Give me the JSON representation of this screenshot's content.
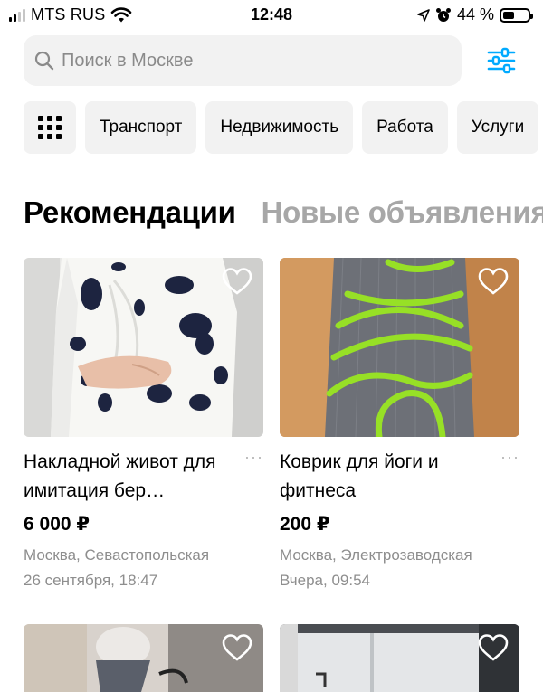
{
  "status": {
    "carrier": "MTS RUS",
    "time": "12:48",
    "battery": "44 %"
  },
  "search": {
    "placeholder": "Поиск в Москве"
  },
  "categories": [
    "Транспорт",
    "Недвижимость",
    "Работа",
    "Услуги"
  ],
  "tabs": {
    "recommendations": "Рекомендации",
    "new": "Новые объявления"
  },
  "items": [
    {
      "title": "Накладной живот для имитация бер…",
      "price": "6 000 ₽",
      "location": "Москва, Севастопольская",
      "date": "26 сентября, 18:47"
    },
    {
      "title": "Коврик для йоги и фитнеса",
      "price": "200 ₽",
      "location": "Москва, Электрозаводская",
      "date": "Вчера, 09:54"
    }
  ],
  "more_label": "···",
  "colors": {
    "accent": "#00aaff",
    "muted": "#8e8e8e",
    "chip_bg": "#f2f2f2",
    "mat_green": "#97e026"
  }
}
